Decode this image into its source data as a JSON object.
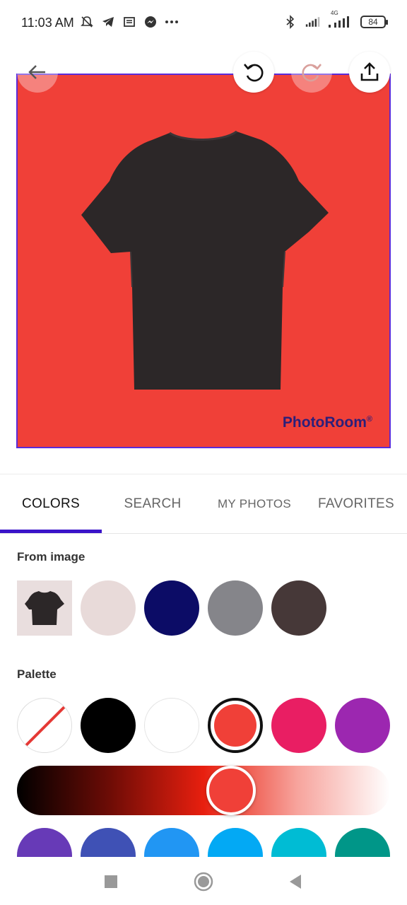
{
  "status_bar": {
    "time": "11:03 AM",
    "battery": "84",
    "network": "4G",
    "left_icons": [
      "mute-icon",
      "telegram-icon",
      "news-icon",
      "messenger-icon",
      "more-dots-icon"
    ],
    "right_icons": [
      "bluetooth-icon",
      "signal-icon",
      "signal-4g-icon",
      "battery-icon"
    ]
  },
  "toolbar": {
    "back_icon": "arrow-left-icon",
    "undo_icon": "undo-icon",
    "redo_icon": "redo-icon",
    "share_icon": "share-icon"
  },
  "canvas": {
    "background_color": "#f04038",
    "watermark": "PhotoRoom",
    "watermark_mark": "®"
  },
  "tabs": [
    {
      "label": "COLORS",
      "active": true
    },
    {
      "label": "SEARCH",
      "active": false
    },
    {
      "label": "MY PHOTOS",
      "active": false
    },
    {
      "label": "FAVORITES",
      "active": false
    }
  ],
  "from_image": {
    "label": "From image",
    "colors": [
      "#e8dad9",
      "#0c0c66",
      "#85858a",
      "#463838"
    ]
  },
  "palette": {
    "label": "Palette",
    "colors": [
      "none",
      "#000000",
      "#ffffff",
      "#f04038",
      "#e91e63",
      "#9c27b0"
    ],
    "selected_index": 3,
    "more_colors": [
      "#673ab7",
      "#3f51b5",
      "#2196f3",
      "#03a9f4",
      "#00bcd4",
      "#009688"
    ]
  },
  "accent_color": "#3a14c9"
}
